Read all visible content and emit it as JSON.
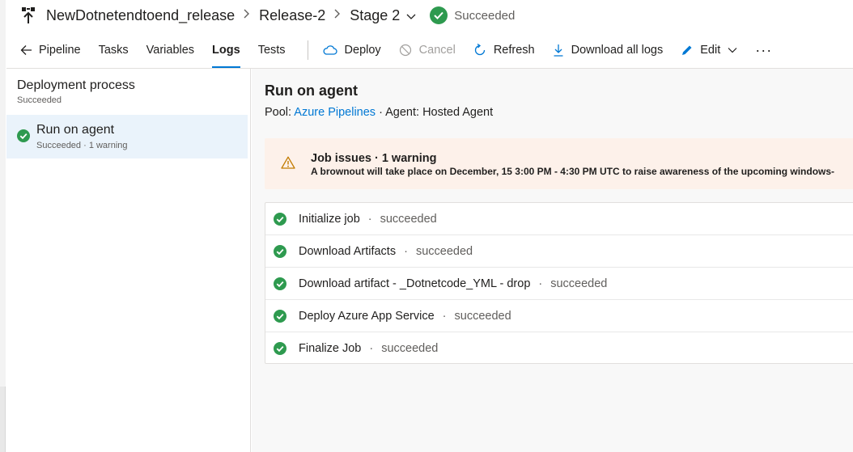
{
  "header": {
    "pipeline_name": "NewDotnetendtoend_release",
    "release": "Release-2",
    "stage": "Stage 2",
    "status": "Succeeded",
    "icon": "pipeline-release-icon",
    "status_color": "#2e9a4f"
  },
  "toolbar": {
    "tabs": [
      {
        "label": "Pipeline",
        "icon": "back-arrow-icon"
      },
      {
        "label": "Tasks"
      },
      {
        "label": "Variables"
      },
      {
        "label": "Logs",
        "active": true
      },
      {
        "label": "Tests"
      }
    ],
    "commands": {
      "deploy": "Deploy",
      "cancel": "Cancel",
      "refresh": "Refresh",
      "download_logs": "Download all logs",
      "edit": "Edit",
      "more": "···"
    },
    "accent_color": "#0078d4"
  },
  "left_panel": {
    "process_title": "Deployment process",
    "process_status": "Succeeded",
    "agent": {
      "name": "Run on agent",
      "status": "Succeeded · 1 warning"
    },
    "selected_bg": "#eaf3fb"
  },
  "main": {
    "title": "Run on agent",
    "pool_label": "Pool:",
    "pool_value": "Azure Pipelines",
    "agent_text": "· Agent: Hosted Agent",
    "warning": {
      "title": "Job issues · 1 warning",
      "message": "A brownout will take place on December, 15 3:00 PM - 4:30 PM UTC to raise awareness of the upcoming windows-",
      "bg": "#fdf1ea",
      "icon": "warning-triangle-icon"
    },
    "steps": [
      {
        "name": "Initialize job",
        "state": "succeeded"
      },
      {
        "name": "Download Artifacts",
        "state": "succeeded"
      },
      {
        "name": "Download artifact - _Dotnetcode_YML - drop",
        "state": "succeeded"
      },
      {
        "name": "Deploy Azure App Service",
        "state": "succeeded"
      },
      {
        "name": "Finalize Job",
        "state": "succeeded"
      }
    ]
  }
}
